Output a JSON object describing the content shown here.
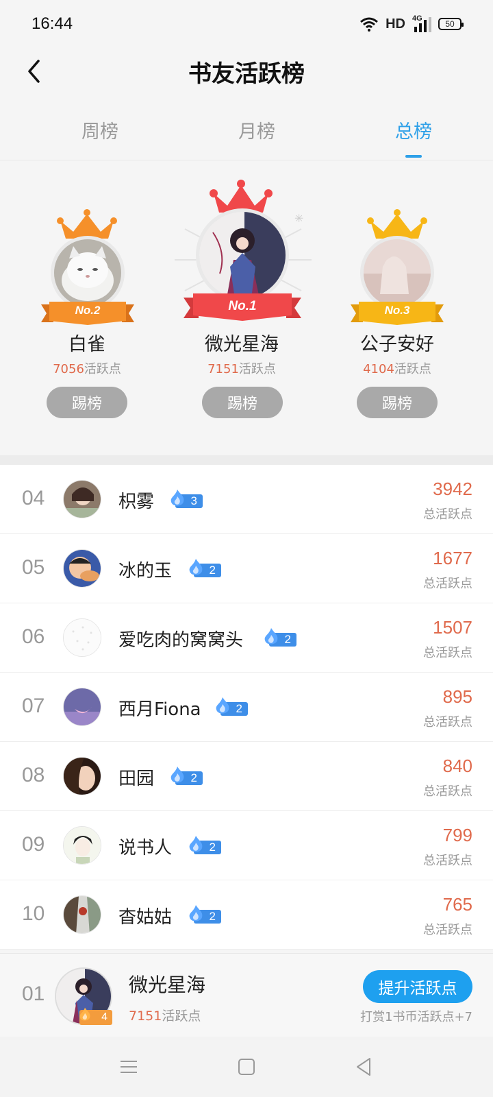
{
  "status": {
    "time": "16:44",
    "network": "HD",
    "cell": "4G",
    "battery": "50"
  },
  "header": {
    "title": "书友活跃榜",
    "back_icon": "chevron-left-icon"
  },
  "tabs": [
    {
      "label": "周榜",
      "active": false
    },
    {
      "label": "月榜",
      "active": false
    },
    {
      "label": "总榜",
      "active": true
    }
  ],
  "podium": {
    "first": {
      "rank_label": "No.1",
      "name": "微光星海",
      "points": "7151",
      "points_suffix": "活跃点",
      "button": "踢榜",
      "crown_color": "#f0484a"
    },
    "second": {
      "rank_label": "No.2",
      "name": "白雀",
      "points": "7056",
      "points_suffix": "活跃点",
      "button": "踢榜",
      "crown_color": "#f5902a"
    },
    "third": {
      "rank_label": "No.3",
      "name": "公子安好",
      "points": "4104",
      "points_suffix": "活跃点",
      "button": "踢榜",
      "crown_color": "#f7b616"
    }
  },
  "list": {
    "points_label": "总活跃点",
    "items": [
      {
        "rank": "04",
        "name": "枳雾",
        "level": "3",
        "points": "3942"
      },
      {
        "rank": "05",
        "name": "冰的玉",
        "level": "2",
        "points": "1677"
      },
      {
        "rank": "06",
        "name": "爱吃肉的窝窝头",
        "level": "2",
        "points": "1507"
      },
      {
        "rank": "07",
        "name": "西月Fiona",
        "level": "2",
        "points": "895"
      },
      {
        "rank": "08",
        "name": "田园",
        "level": "2",
        "points": "840"
      },
      {
        "rank": "09",
        "name": "说书人",
        "level": "2",
        "points": "799"
      },
      {
        "rank": "10",
        "name": "杳姑姑",
        "level": "2",
        "points": "765"
      }
    ]
  },
  "my_rank": {
    "rank": "01",
    "name": "微光星海",
    "level": "4",
    "points": "7151",
    "points_suffix": "活跃点",
    "boost_button": "提升活跃点",
    "hint": "打赏1书币活跃点+7"
  },
  "colors": {
    "accent": "#2ea0e8",
    "points": "#e06a4c",
    "boost": "#1ea0ef"
  }
}
